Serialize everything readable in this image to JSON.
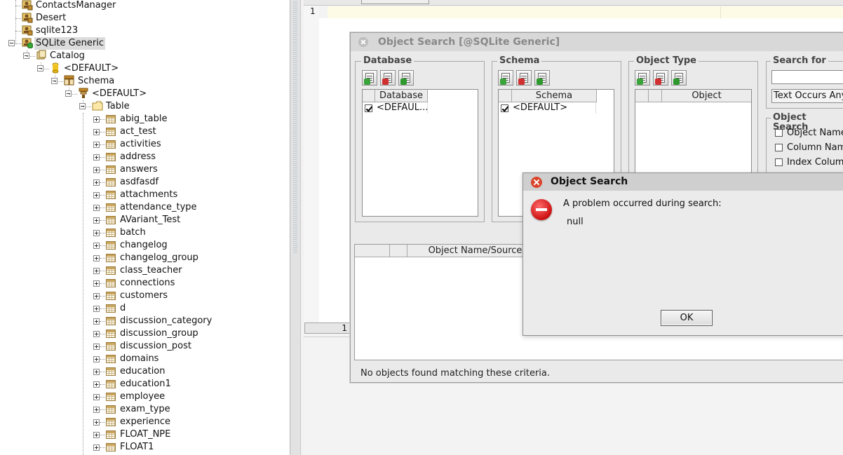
{
  "tree": {
    "connections": [
      "ContactsManager",
      "Desert",
      "sqlite123",
      "SQLite Generic"
    ],
    "catalog": "Catalog",
    "default_catalog": "<DEFAULT>",
    "schema": "Schema",
    "default_schema": "<DEFAULT>",
    "table_folder": "Table",
    "tables": [
      "abig_table",
      "act_test",
      "activities",
      "address",
      "answers",
      "asdfasdf",
      "attachments",
      "attendance_type",
      "AVariant_Test",
      "batch",
      "changelog",
      "changelog_group",
      "class_teacher",
      "connections",
      "customers",
      "d",
      "discussion_category",
      "discussion_group",
      "discussion_post",
      "domains",
      "education",
      "education1",
      "employee",
      "exam_type",
      "experience",
      "FLOAT_NPE",
      "FLOAT1"
    ]
  },
  "editor": {
    "line_number": "1",
    "status_line": "1"
  },
  "object_search": {
    "title": "Object Search [@SQLite Generic]",
    "database_group": "Database",
    "database_header": "Database",
    "database_value": "<DEFAUL...",
    "schema_group": "Schema",
    "schema_header": "Schema",
    "schema_value": "<DEFAULT>",
    "object_type_group": "Object Type",
    "object_header": "Object",
    "search_for_group": "Search for",
    "search_for_value": "",
    "match_mode": "Text Occurs Any",
    "object_search_group": "Object Search",
    "options": [
      "Object Name",
      "Column Name",
      "Index Column"
    ],
    "results_header": "Object Name/Source",
    "status": "No objects found matching these criteria."
  },
  "error_dialog": {
    "title": "Object Search",
    "message": "A problem occurred during search:",
    "detail": "null",
    "ok_label": "OK"
  }
}
